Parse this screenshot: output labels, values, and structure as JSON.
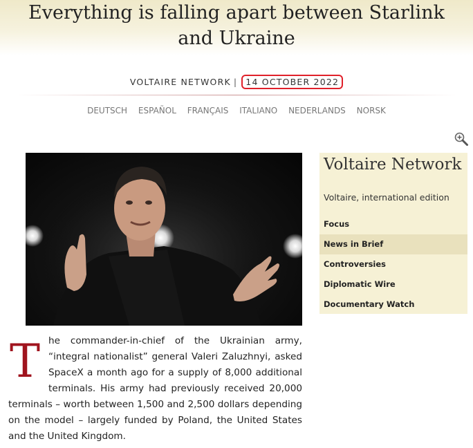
{
  "article": {
    "title": "Everything is falling apart between Starlink and Ukraine",
    "publisher": "VOLTAIRE NETWORK",
    "separator": "|",
    "date": "14 OCTOBER 2022",
    "dropcap": "T",
    "body": "he commander-in-chief of the Ukrainian army, “integral nationalist” general Valeri Zaluzhnyi, asked SpaceX a month ago for a supply of 8,000 additional terminals. His army had previously received 20,000 terminals – worth between 1,500 and 2,500 dollars depending on the model – largely funded by Poland, the United States and the United Kingdom."
  },
  "languages": [
    "DEUTSCH",
    "ESPAÑOL",
    "FRANÇAIS",
    "ITALIANO",
    "NEDERLANDS",
    "NORSK"
  ],
  "icons": {
    "zoom": "zoom-in-magnifier-icon"
  },
  "sidebar": {
    "title": "Voltaire Network",
    "subtitle": "Voltaire, international edition",
    "items": [
      {
        "label": "Focus",
        "active": false
      },
      {
        "label": "News in Brief",
        "active": true
      },
      {
        "label": "Controversies",
        "active": false
      },
      {
        "label": "Diplomatic Wire",
        "active": false
      },
      {
        "label": "Documentary Watch",
        "active": false
      }
    ]
  },
  "colors": {
    "dropcap": "#a0141e",
    "sidebar_bg": "#f6f1d5",
    "sidebar_active": "#e9e1bd",
    "date_highlight": "#e0202a"
  }
}
